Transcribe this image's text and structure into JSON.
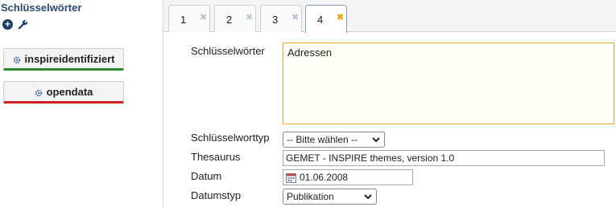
{
  "left": {
    "title": "Schlüsselwörter",
    "add_icon": "plus-circle-icon",
    "wrench_icon": "wrench-icon",
    "keywords": [
      {
        "label": "inspireidentifiziert",
        "accent": "#2a8a2a"
      },
      {
        "label": "opendata",
        "accent": "#cc2222"
      }
    ]
  },
  "tabs": [
    {
      "label": "1",
      "close": "✖"
    },
    {
      "label": "2",
      "close": "✖"
    },
    {
      "label": "3",
      "close": "✖"
    },
    {
      "label": "4",
      "close": "✖",
      "active": true
    }
  ],
  "form": {
    "keywords_label": "Schlüsselwörter",
    "keywords_value": "Adressen",
    "keyword_type_label": "Schlüsselworttyp",
    "keyword_type_value": "-- Bitte wählen --",
    "thesaurus_label": "Thesaurus",
    "thesaurus_value": "GEMET - INSPIRE themes, version 1.0",
    "date_label": "Datum",
    "date_value": "01.06.2008",
    "date_type_label": "Datumstyp",
    "date_type_value": "Publikation"
  },
  "colors": {
    "title": "#2a4a6e",
    "active_tab_close": "#e6a817",
    "textarea_border": "#e3a631"
  }
}
